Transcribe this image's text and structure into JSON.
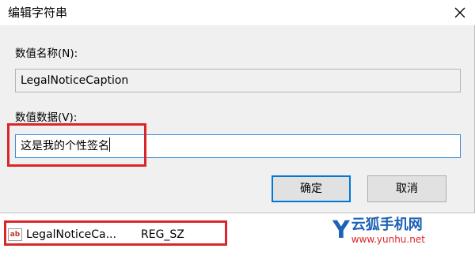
{
  "window": {
    "title": "编辑字符串",
    "close_glyph": "✕"
  },
  "value_name": {
    "label": "数值名称(N):",
    "value": "LegalNoticeCaption"
  },
  "value_data": {
    "label": "数值数据(V):",
    "value": "这是我的个性签名"
  },
  "buttons": {
    "ok_label": "确定",
    "cancel_label": "取消"
  },
  "registry_entry": {
    "icon_text": "ab",
    "name": "LegalNoticeCa...",
    "type": "REG_SZ"
  },
  "watermark": {
    "logo": "Y",
    "title": "云狐手机网",
    "url": "www.yunhu.net"
  },
  "colors": {
    "highlight": "#d9262b",
    "accent": "#0078d7"
  }
}
